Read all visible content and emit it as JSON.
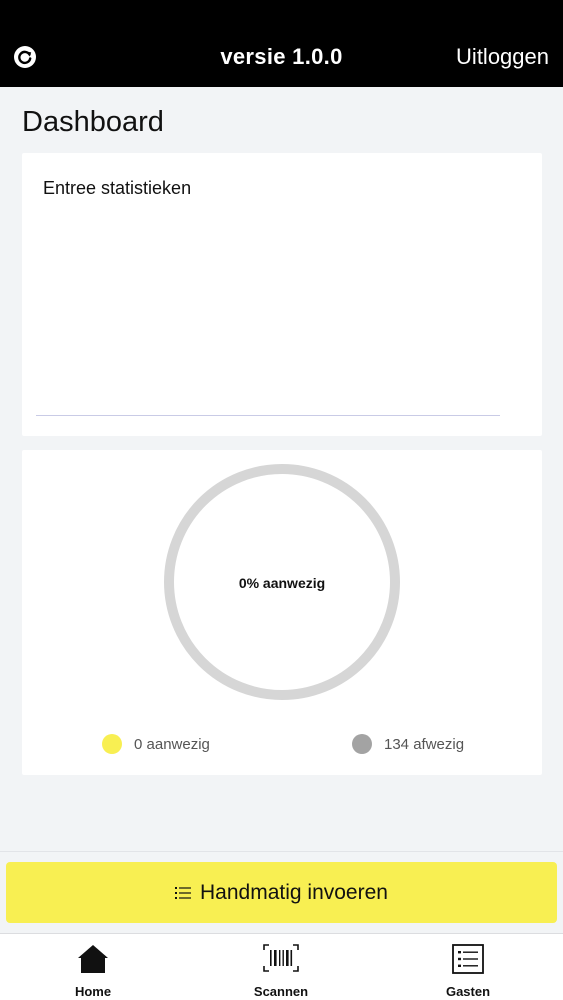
{
  "header": {
    "title": "versie 1.0.0",
    "logout_label": "Uitloggen",
    "refresh_icon": "refresh-icon"
  },
  "page": {
    "title": "Dashboard"
  },
  "stats_card": {
    "title": "Entree statistieken"
  },
  "attendance": {
    "ring_label": "0% aanwezig",
    "present_fraction": 0,
    "present_label": "0 aanwezig",
    "absent_label": "134 afwezig",
    "present_color": "#f8ef52",
    "absent_color": "#a3a3a3",
    "ring_color": "#d6d6d6"
  },
  "manual_button": {
    "label": "Handmatig invoeren",
    "icon": "list-icon"
  },
  "tabbar": {
    "items": [
      {
        "label": "Home",
        "icon": "home-icon"
      },
      {
        "label": "Scannen",
        "icon": "barcode-icon"
      },
      {
        "label": "Gasten",
        "icon": "guest-list-icon"
      }
    ]
  }
}
